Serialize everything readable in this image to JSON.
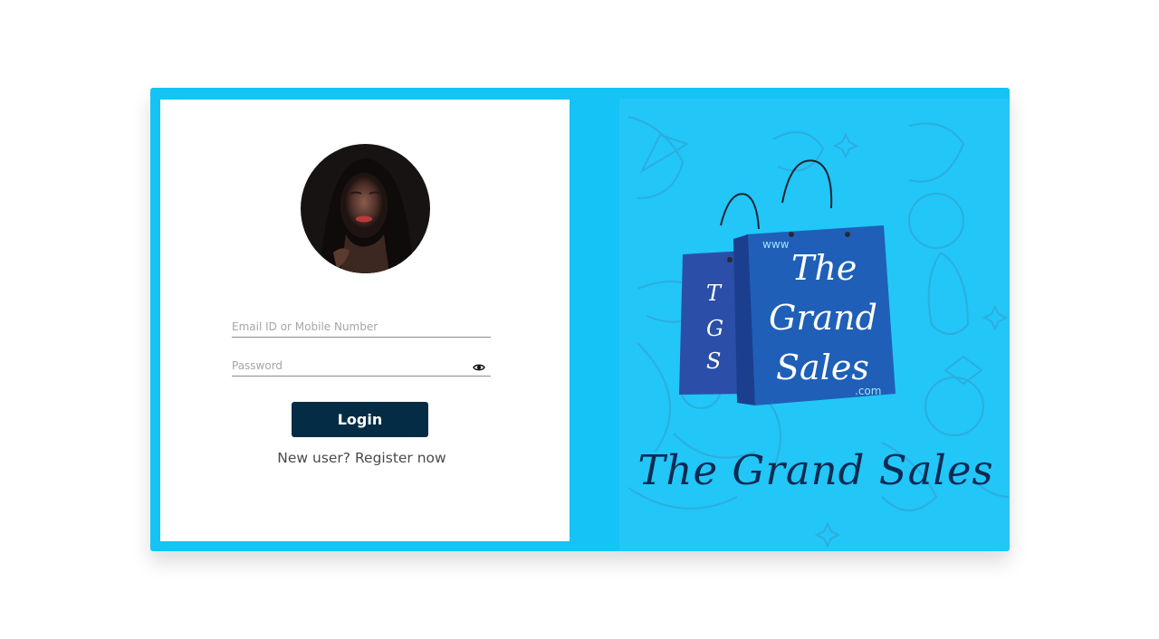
{
  "login_form": {
    "email_placeholder": "Email ID or Mobile Number",
    "password_placeholder": "Password",
    "login_label": "Login",
    "register_prompt": "New user?",
    "register_link": "Register now"
  },
  "brand": {
    "logo_small_bag_text": "T G S",
    "logo_large_bag_line1": "The",
    "logo_large_bag_line2": "Grand",
    "logo_large_bag_line3": "Sales",
    "logo_www": "www",
    "logo_dotcom": ".com",
    "title": "The Grand Sales"
  },
  "icons": {
    "password_toggle": "eye-icon",
    "profile": "avatar"
  },
  "colors": {
    "card_background": "#15c3f6",
    "art_background": "#22c6f7",
    "login_button": "#052c45",
    "brand_text": "#0c2a52",
    "bag_blue": "#1f5fb8"
  }
}
